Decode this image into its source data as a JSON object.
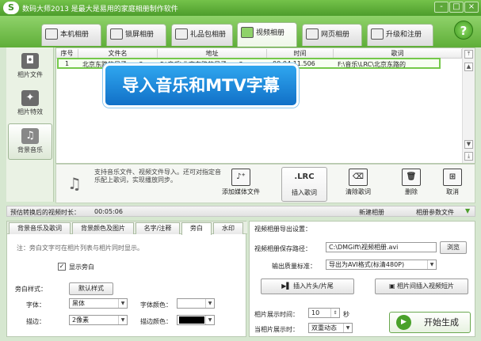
{
  "titlebar": {
    "logo": "S",
    "title": "数码大师2013 是最大是易用的家庭相册制作软件",
    "controls": [
      "-",
      "□",
      "×"
    ]
  },
  "tabs": [
    {
      "label": "本机相册",
      "icon": "photo-album-icon",
      "active": false
    },
    {
      "label": "锁屏相册",
      "icon": "monitor-icon",
      "active": false
    },
    {
      "label": "礼品包相册",
      "icon": "gift-icon",
      "active": false
    },
    {
      "label": "视频相册",
      "icon": "film-icon",
      "active": true
    },
    {
      "label": "网页相册",
      "icon": "web-icon",
      "active": false
    },
    {
      "label": "升级和注册",
      "icon": "user-icon",
      "active": false
    }
  ],
  "help_icon": "?",
  "sidebar": {
    "items": [
      {
        "label": "相片文件",
        "icon": "camera-icon",
        "glyph": "◘"
      },
      {
        "label": "相片特效",
        "icon": "effects-icon",
        "glyph": "✦"
      },
      {
        "label": "背景音乐",
        "icon": "music-icon",
        "glyph": "♫"
      }
    ]
  },
  "table": {
    "headers": [
      "序号",
      "文件名",
      "地址",
      "时间",
      "歌词"
    ],
    "rows": [
      [
        "1",
        "北京东路的日子.mp3",
        "F:\\音乐\\北京东路的日子.mp3",
        "00:04:11.506",
        "F:\\音乐\\LRC\\北京东路的"
      ]
    ]
  },
  "banner": "导入音乐和MTV字幕",
  "toolbar": {
    "note": "支持音乐文件、视频文件导入。还可对指定音乐配上歌词，实现播放同步。",
    "buttons": [
      {
        "label": "添加媒体文件",
        "icon": "add-media-icon",
        "glyph": "♪⁺"
      },
      {
        "label": "插入歌词",
        "icon": "lrc-icon",
        "glyph": ".LRC"
      },
      {
        "label": "清除歌词",
        "icon": "clear-lyrics-icon",
        "glyph": "⌫"
      },
      {
        "label": "删除",
        "icon": "trash-icon",
        "glyph": "🗑"
      },
      {
        "label": "取消",
        "icon": "cancel-icon",
        "glyph": "⊞"
      }
    ]
  },
  "duration": {
    "label": "预估转换后的视频时长：",
    "value": "00:05:06",
    "new_album": "新建相册",
    "params": "相册参数文件"
  },
  "left_panel": {
    "tabs": [
      "背景音乐及歌词",
      "背景颜色及图片",
      "名字/注释",
      "旁白",
      "水印"
    ],
    "note": "注：旁白文字可在相片列表与相片同时显示。",
    "show_narration": "显示旁白",
    "style_label": "旁白样式：",
    "style_button": "默认样式",
    "font_label": "字体：",
    "font_value": "黑体",
    "font_color_label": "字体颜色：",
    "stroke_label": "描边：",
    "stroke_value": "2像素",
    "stroke_color_label": "描边颜色："
  },
  "right_panel": {
    "title": "视频相册导出设置：",
    "path_label": "视频相册保存路径：",
    "path_value": "C:\\DMGift\\视频相册.avi",
    "browse": "浏览",
    "quality_label": "输出质量标准：",
    "quality_value": "导出为AVI格式(标清480P)",
    "insert_head_tail": "插入片头/片尾",
    "insert_clip": "相片间插入视频短片",
    "show_time_label": "相片展示时间：",
    "show_time_value": "10",
    "show_time_unit": "秒",
    "show_mode_label": "当相片展示时：",
    "show_mode_value": "双重动态",
    "generate": "开始生成"
  },
  "colors": {
    "accent": "#5fae38",
    "row_highlight": "#74c84a",
    "banner": "#1b86da"
  }
}
